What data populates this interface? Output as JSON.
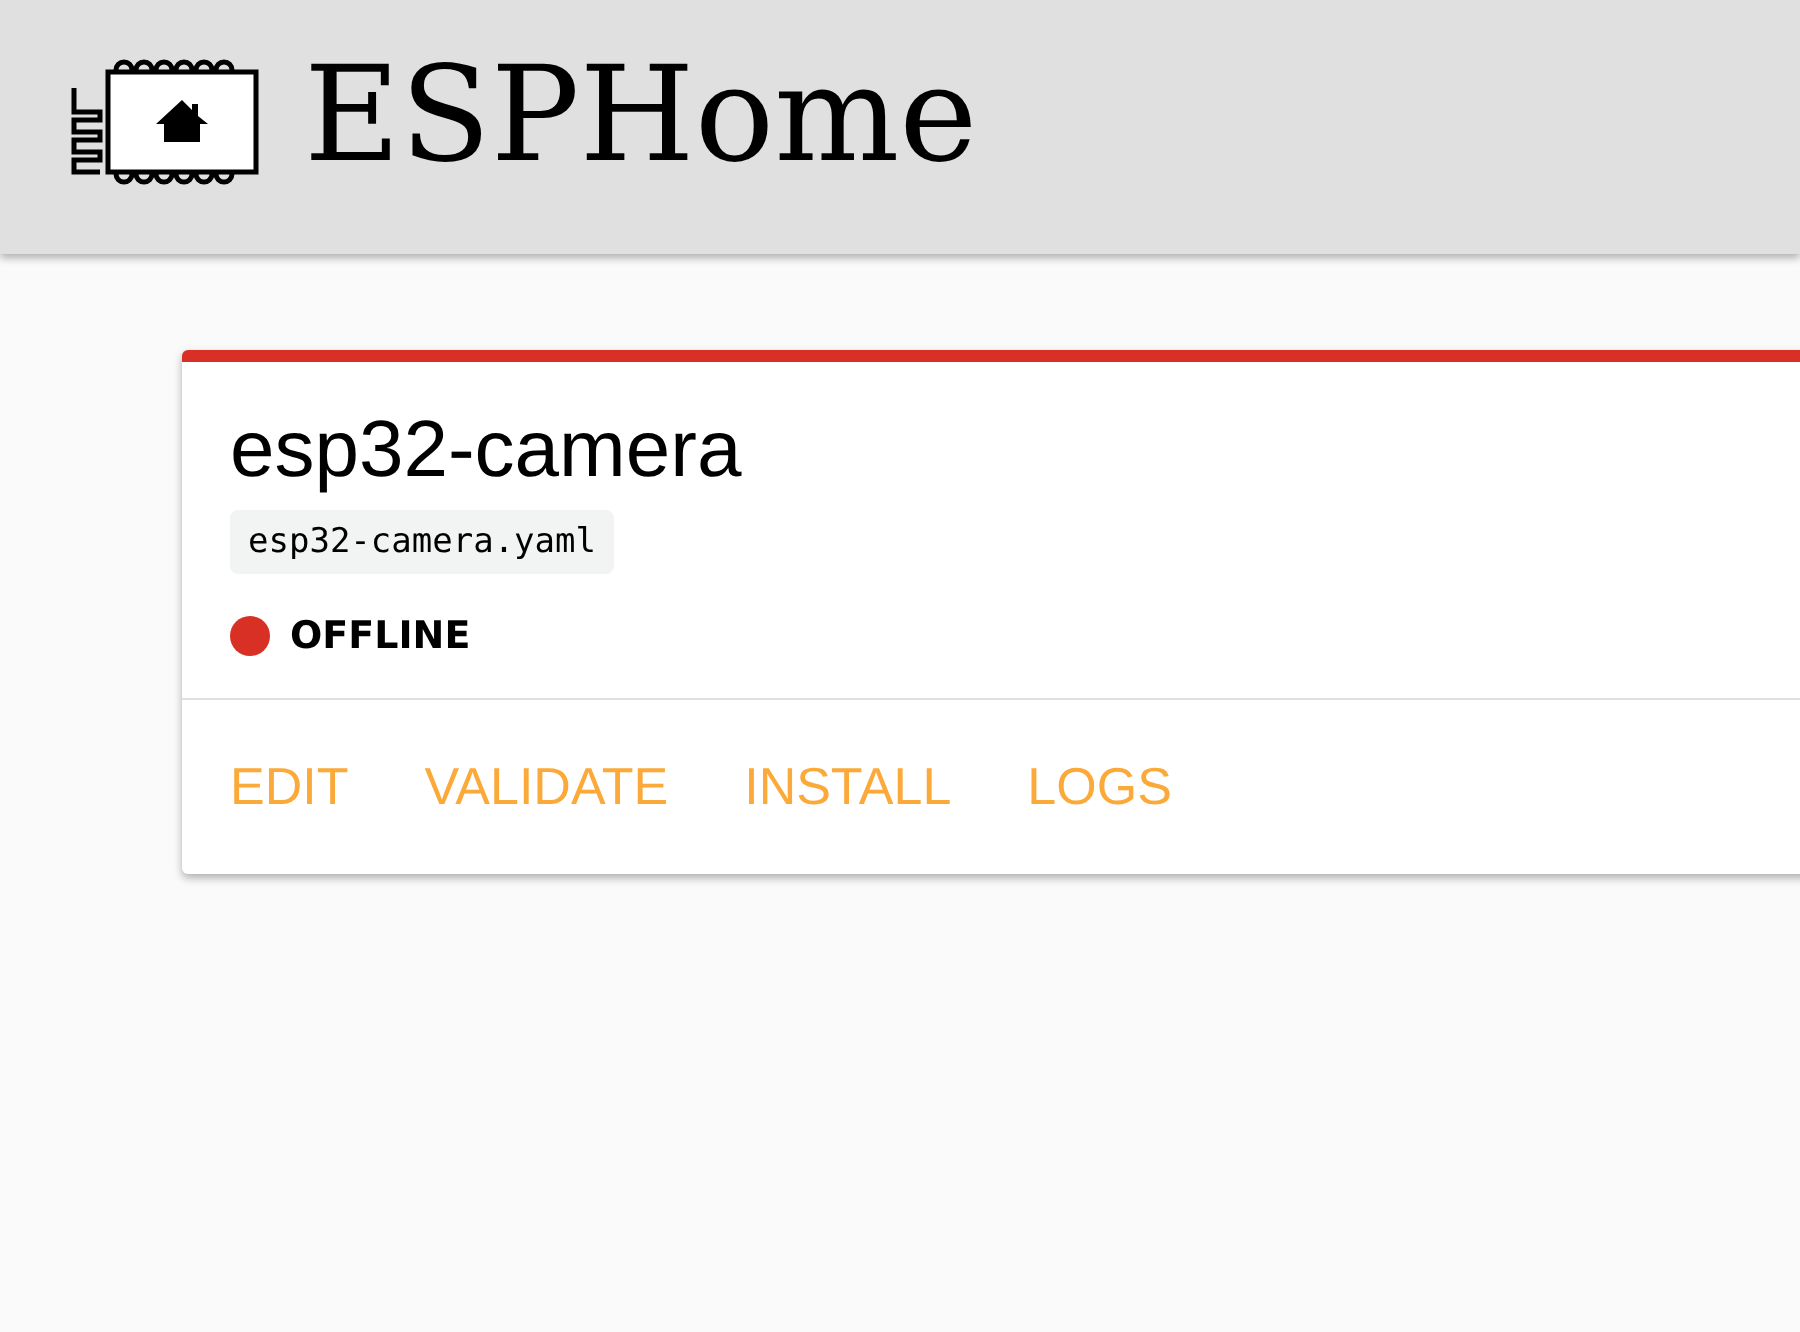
{
  "header": {
    "title": "ESPHome"
  },
  "device_card": {
    "name": "esp32-camera",
    "file": "esp32-camera.yaml",
    "status": {
      "label": "OFFLINE",
      "color": "#d93025"
    },
    "actions": [
      {
        "label": "EDIT"
      },
      {
        "label": "VALIDATE"
      },
      {
        "label": "INSTALL"
      },
      {
        "label": "LOGS"
      }
    ]
  }
}
